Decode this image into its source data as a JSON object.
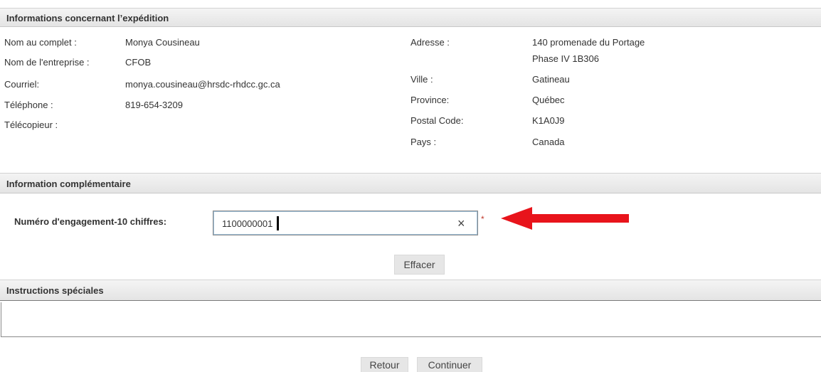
{
  "shipping": {
    "header": "Informations concernant l’expédition",
    "name_label": "Nom au complet :",
    "name_value": "Monya Cousineau",
    "company_label": "Nom de l'entreprise :",
    "company_value": "CFOB",
    "email_label": "Courriel:",
    "email_value": "monya.cousineau@hrsdc-rhdcc.gc.ca",
    "phone_label": "Téléphone :",
    "phone_value": "819-654-3209",
    "fax_label": "Télécopieur :",
    "fax_value": "",
    "address_label": "Adresse :",
    "address_line1": "140 promenade du Portage",
    "address_line2": "Phase IV 1B306",
    "city_label": "Ville :",
    "city_value": "Gatineau",
    "province_label": "Province:",
    "province_value": "Québec",
    "postal_label": "Postal Code:",
    "postal_value": "K1A0J9",
    "country_label": "Pays :",
    "country_value": "Canada"
  },
  "complementary": {
    "header": "Information complémentaire",
    "engagement_label": "Numéro d'engagement-10 chiffres:",
    "engagement_value": "1100000001",
    "clear_glyph": "×",
    "required_marker": "*",
    "clear_button": "Effacer"
  },
  "instructions": {
    "header": "Instructions spéciales",
    "value": ""
  },
  "footer": {
    "back_button": "Retour",
    "continue_button": "Continuer"
  },
  "colors": {
    "annotation_arrow": "#e8141b",
    "required_marker": "#c0392b"
  }
}
